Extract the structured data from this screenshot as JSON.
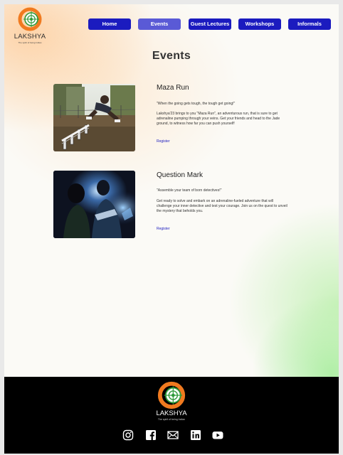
{
  "brand": {
    "name": "LAKSHYA",
    "tagline": "The spirit of being Indian"
  },
  "nav": {
    "items": [
      {
        "label": "Home"
      },
      {
        "label": "Events"
      },
      {
        "label": "Guest Lectures"
      },
      {
        "label": "Workshops"
      },
      {
        "label": "Informals"
      }
    ],
    "active": "Events"
  },
  "page": {
    "title": "Events"
  },
  "events": [
    {
      "name": "Maza Run",
      "quote": "\"When the going gets tough, the tough get going!\"",
      "description": "Lakshya'23 brings to you \"Maza Run\", an adventurous run, that is sure to get adrenaline pumping through your veins. Get your friends and head to the Jade ground, to witness how far you can push yourself!",
      "register": "Register"
    },
    {
      "name": "Question Mark",
      "quote": "\"Assemble your team of born detectives!\"",
      "description": "Get ready to solve and embark on an adrenaline-fueled adventure that will challenge your inner detective and test your courage. Join us on the quest to unveil the mystery that beholds you.",
      "register": "Register"
    }
  ],
  "footer": {
    "brand": "LAKSHYA",
    "tagline": "The spirit of being Indian",
    "socials": [
      "instagram-icon",
      "facebook-icon",
      "mail-icon",
      "linkedin-icon",
      "youtube-icon"
    ]
  },
  "colors": {
    "nav_button": "#1b1bbf",
    "nav_active": "#5a5ad6",
    "logo_orange": "#f07a1f",
    "logo_green": "#2e9a3a",
    "footer_bg": "#000000",
    "link": "#1b1bbf"
  }
}
